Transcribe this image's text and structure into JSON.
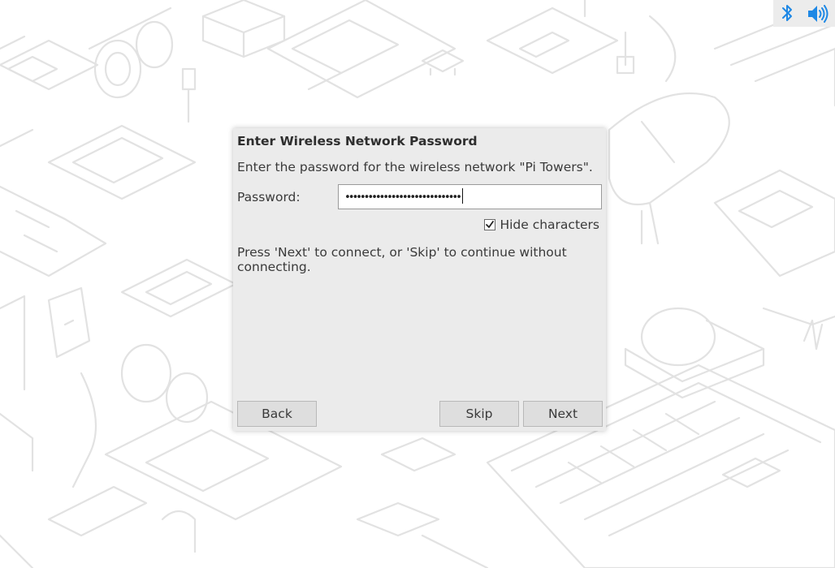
{
  "dialog": {
    "title": "Enter Wireless Network Password",
    "message": "Enter the password for the wireless network \"Pi Towers\".",
    "password_label": "Password:",
    "password_value": "••••••••••••••••••••••••••••••",
    "hide_characters_label": "Hide characters",
    "hide_characters_checked": true,
    "hint": "Press 'Next' to connect, or 'Skip' to continue without connecting.",
    "buttons": {
      "back": "Back",
      "skip": "Skip",
      "next": "Next"
    }
  },
  "tray": {
    "icons": [
      "bluetooth-icon",
      "volume-icon"
    ],
    "accent_color": "#1e88e5"
  }
}
